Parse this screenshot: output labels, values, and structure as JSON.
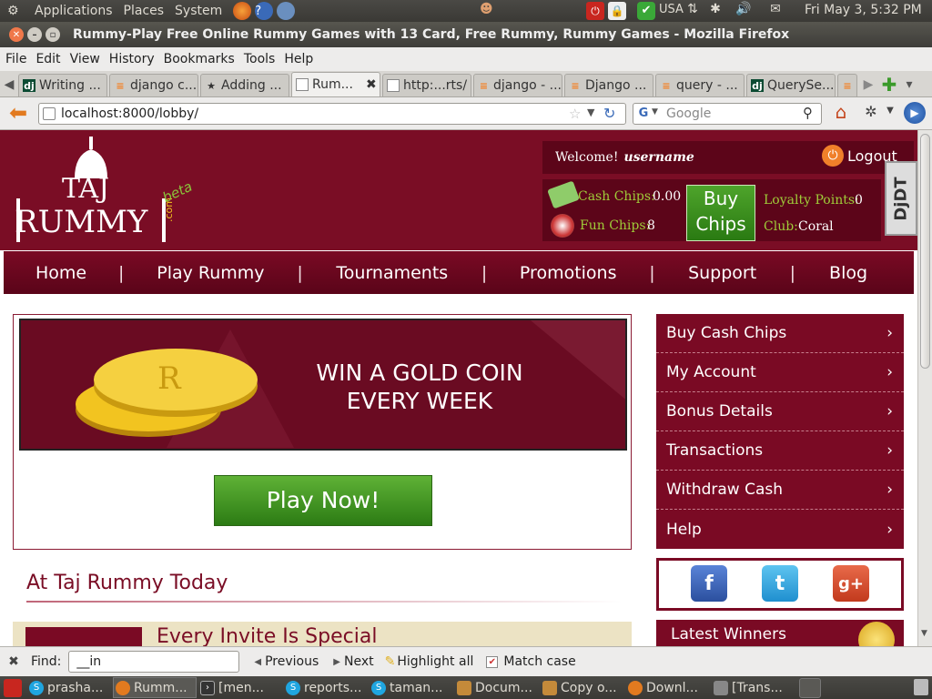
{
  "top_panel": {
    "applications": "Applications",
    "places": "Places",
    "system": "System",
    "keyboard_layout": "USA",
    "clock": "Fri May  3,  5:32 PM"
  },
  "window": {
    "title": "Rummy-Play Free Online Rummy Games with 13 Card, Free Rummy, Rummy Games - Mozilla Firefox"
  },
  "menu": [
    "File",
    "Edit",
    "View",
    "History",
    "Bookmarks",
    "Tools",
    "Help"
  ],
  "tabs": [
    {
      "label": "Writing ...",
      "icon": "dj"
    },
    {
      "label": "django c...",
      "icon": "stack"
    },
    {
      "label": "Adding ...",
      "icon": "star"
    },
    {
      "label": "Rum...",
      "icon": "page"
    },
    {
      "label": "http:...rts/",
      "icon": "page"
    },
    {
      "label": "django - ...",
      "icon": "stack"
    },
    {
      "label": "Django ...",
      "icon": "stack"
    },
    {
      "label": "query - ...",
      "icon": "stack"
    },
    {
      "label": "QuerySe...",
      "icon": "dj"
    }
  ],
  "address_bar": {
    "url": "localhost:8000/lobby/"
  },
  "search_box": {
    "placeholder": "Google"
  },
  "site": {
    "logo_line1": "TAJ",
    "logo_line2": "RUMMY",
    "logo_com": ".com",
    "logo_beta": "beta",
    "welcome": "Welcome!",
    "username": "username",
    "logout": "Logout",
    "cash_chips_label": "Cash Chips:",
    "cash_chips_value": "0.00",
    "fun_chips_label": "Fun Chips:",
    "fun_chips_value": "8",
    "buy_chips_line1": "Buy",
    "buy_chips_line2": "Chips",
    "loyalty_label": "Loyalty Points:",
    "loyalty_value": "0",
    "club_label": "Club:",
    "club_value": "Coral",
    "nav": [
      "Home",
      "Play Rummy",
      "Tournaments",
      "Promotions",
      "Support",
      "Blog"
    ],
    "banner_line1": "WIN A GOLD COIN",
    "banner_line2": "EVERY WEEK",
    "play_now": "Play Now!",
    "today_heading": "At Taj Rummy Today",
    "promo_text": "Every Invite Is Special",
    "side_menu": [
      "Buy Cash Chips",
      "My Account",
      "Bonus Details",
      "Transactions",
      "Withdraw Cash",
      "Help"
    ],
    "latest_winners": "Latest Winners",
    "ddt_tab": "DjDT"
  },
  "find_bar": {
    "label": "Find:",
    "value": "__in",
    "previous": "Previous",
    "next": "Next",
    "highlight_all": "Highlight all",
    "match_case": "Match case"
  },
  "taskbar": [
    {
      "label": "prasha...",
      "icon": "skype"
    },
    {
      "label": "Rumm...",
      "icon": "firefox"
    },
    {
      "label": "[men...",
      "icon": "terminal"
    },
    {
      "label": "reports...",
      "icon": "skype"
    },
    {
      "label": "taman...",
      "icon": "skype"
    },
    {
      "label": "Docum...",
      "icon": "folder"
    },
    {
      "label": "Copy o...",
      "icon": "folder"
    },
    {
      "label": "Downl...",
      "icon": "firefox"
    },
    {
      "label": "[Trans...",
      "icon": "app"
    }
  ],
  "colors": {
    "brand": "#7a0d25",
    "nav": "#7a0a24",
    "green": "#3d9420",
    "gold": "#f2c420"
  }
}
